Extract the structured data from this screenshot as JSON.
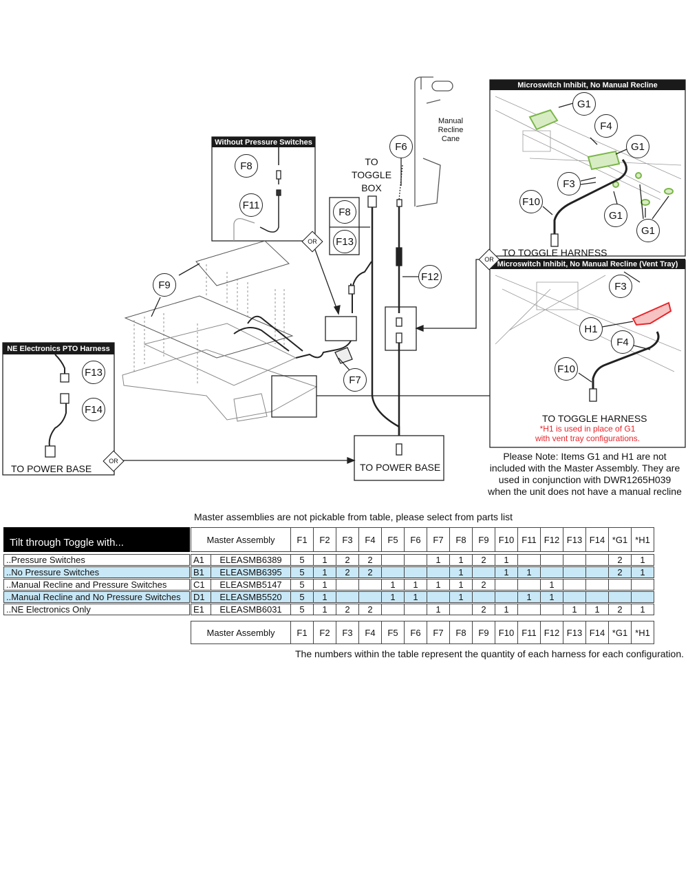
{
  "panels": {
    "without_pressure": {
      "title": "Without Pressure Switches",
      "callouts": [
        "F8",
        "F11"
      ]
    },
    "ne_electronics": {
      "title": "NE Electronics PTO Harness",
      "callouts": [
        "F13",
        "F14"
      ],
      "footer": "TO POWER BASE"
    },
    "microswitch": {
      "title": "Microswitch Inhibit, No Manual Recline",
      "callouts": [
        "G1",
        "F4",
        "G1",
        "F3",
        "F10",
        "G1",
        "G1"
      ],
      "footer": "TO TOGGLE HARNESS"
    },
    "vent_tray": {
      "title": "Microswitch Inhibit, No Manual Recline (Vent Tray)",
      "callouts": [
        "F3",
        "H1",
        "F4",
        "F10"
      ],
      "footer": "TO TOGGLE HARNESS",
      "red_note_1": "*H1 is used in place of G1",
      "red_note_2": "with vent tray configurations."
    }
  },
  "labels": {
    "manual_recline_cane": [
      "Manual",
      "Recline",
      "Cane"
    ],
    "to_toggle_box": [
      "TO",
      "TOGGLE",
      "BOX"
    ],
    "to_power_base": "TO POWER BASE",
    "or": "OR"
  },
  "callouts": {
    "f6": "F6",
    "f8": "F8",
    "f13": "F13",
    "f9": "F9",
    "f12": "F12",
    "f7": "F7"
  },
  "colors": {
    "g1_highlight": "#7ab648",
    "h1_highlight": "#e8242a",
    "row_highlight": "#c8e8f7"
  },
  "note": [
    "Please Note: Items G1 and H1 are not",
    "included with the Master Assembly. They are",
    "used in conjunction with DWR1265H039",
    "when the unit does not have a manual recline"
  ],
  "table": {
    "caption": "Master assemblies are not pickable from table, please select from parts list",
    "title": "Tilt through Toggle with...",
    "master_header": "Master Assembly",
    "columns": [
      "F1",
      "F2",
      "F3",
      "F4",
      "F5",
      "F6",
      "F7",
      "F8",
      "F9",
      "F10",
      "F11",
      "F12",
      "F13",
      "F14",
      "*G1",
      "*H1"
    ],
    "rows": [
      {
        "label": "..Pressure Switches",
        "code": "A1",
        "part": "ELEASMB6389",
        "highlight": false,
        "values": [
          "5",
          "1",
          "2",
          "2",
          "",
          "",
          "1",
          "1",
          "2",
          "1",
          "",
          "",
          "",
          "",
          "2",
          "1"
        ]
      },
      {
        "label": "..No Pressure Switches",
        "code": "B1",
        "part": "ELEASMB6395",
        "highlight": true,
        "values": [
          "5",
          "1",
          "2",
          "2",
          "",
          "",
          "",
          "1",
          "",
          "1",
          "1",
          "",
          "",
          "",
          "2",
          "1"
        ]
      },
      {
        "label": "..Manual Recline and Pressure Switches",
        "code": "C1",
        "part": "ELEASMB5147",
        "highlight": false,
        "values": [
          "5",
          "1",
          "",
          "",
          "1",
          "1",
          "1",
          "1",
          "2",
          "",
          "",
          "1",
          "",
          "",
          "",
          ""
        ]
      },
      {
        "label": "..Manual Recline and No Pressure Switches",
        "code": "D1",
        "part": "ELEASMB5520",
        "highlight": true,
        "values": [
          "5",
          "1",
          "",
          "",
          "1",
          "1",
          "",
          "1",
          "",
          "",
          "1",
          "1",
          "",
          "",
          "",
          ""
        ]
      },
      {
        "label": "..NE Electronics Only",
        "code": "E1",
        "part": "ELEASMB6031",
        "highlight": false,
        "values": [
          "5",
          "1",
          "2",
          "2",
          "",
          "",
          "1",
          "",
          "2",
          "1",
          "",
          "",
          "1",
          "1",
          "2",
          "1"
        ]
      }
    ],
    "footnote": "The numbers within the table represent the quantity of each harness for each configuration."
  }
}
